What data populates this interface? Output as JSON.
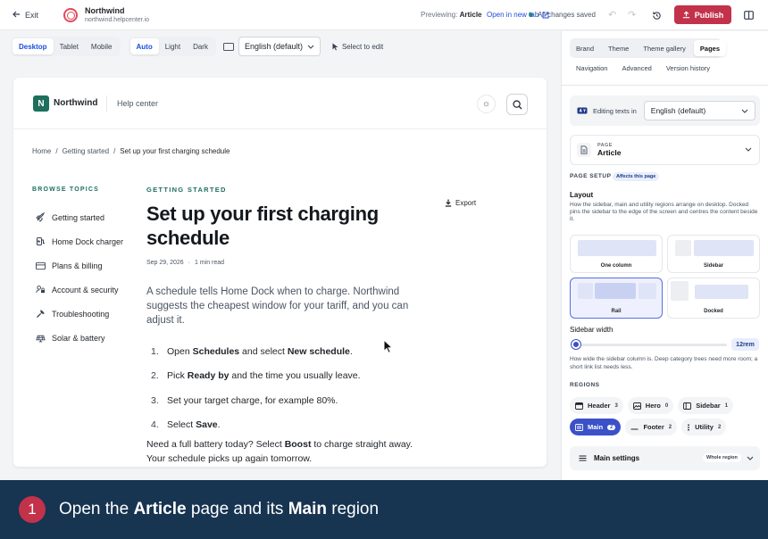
{
  "topbar": {
    "exit_label": "Exit",
    "brand_name": "Northwind",
    "brand_url": "northwind.helpcenter.io",
    "status": "All changes saved",
    "publish_label": "Publish"
  },
  "toolbar": {
    "devices": [
      "Desktop",
      "Tablet",
      "Mobile"
    ],
    "active_device": "Desktop",
    "themes": [
      "Auto",
      "Light",
      "Dark"
    ],
    "active_theme": "Auto",
    "language": "English (default)",
    "select_to_edit": "Select to edit",
    "previewing_label": "Previewing:",
    "previewing_value": "Article",
    "open_new_tab": "Open in new tab"
  },
  "site": {
    "name": "Northwind",
    "logo_letter": "N",
    "help_center": "Help center",
    "breadcrumbs": [
      "Home",
      "Getting started",
      "Set up your first charging schedule"
    ],
    "browse_topics": "BROWSE TOPICS",
    "topics": [
      {
        "label": "Getting started",
        "icon": "rocket-icon"
      },
      {
        "label": "Home Dock charger",
        "icon": "charger-icon"
      },
      {
        "label": "Plans & billing",
        "icon": "card-icon"
      },
      {
        "label": "Account & security",
        "icon": "user-lock-icon"
      },
      {
        "label": "Troubleshooting",
        "icon": "wrench-icon"
      },
      {
        "label": "Solar & battery",
        "icon": "solar-icon"
      }
    ]
  },
  "article": {
    "category": "GETTING STARTED",
    "export": "Export",
    "title": "Set up your first charging schedule",
    "date": "Sep 29, 2026",
    "read_time": "1 min read",
    "lead": "A schedule tells Home Dock when to charge. Northwind suggests the cheapest window for your tariff, and you can adjust it.",
    "steps": [
      {
        "num": "1.",
        "parts": [
          "Open ",
          "Schedules",
          " and select ",
          "New schedule",
          "."
        ]
      },
      {
        "num": "2.",
        "parts": [
          "Pick ",
          "Ready by",
          " and the time you usually leave."
        ]
      },
      {
        "num": "3.",
        "parts": [
          "Set your target charge, for example 80%."
        ]
      },
      {
        "num": "4.",
        "parts": [
          "Select ",
          "Save",
          "."
        ]
      }
    ],
    "after": [
      "Need a full battery today? Select ",
      "Boost",
      " to charge straight away. Your schedule picks up again tomorrow."
    ]
  },
  "panel": {
    "tabs_row1": [
      "Brand",
      "Theme",
      "Theme gallery",
      "Pages"
    ],
    "tabs_row2": [
      "Navigation",
      "Advanced",
      "Version history"
    ],
    "active_tab": "Pages",
    "editing_texts_label": "Editing texts in",
    "editing_language": "English (default)",
    "page_kicker": "PAGE",
    "page_value": "Article",
    "page_setup": "PAGE SETUP",
    "affects": "Affects this page",
    "layout_title": "Layout",
    "layout_desc": "How the sidebar, main and utility regions arrange on desktop. Docked pins the sidebar to the edge of the screen and centres the content beside it.",
    "layouts": [
      "One column",
      "Sidebar",
      "Rail",
      "Docked"
    ],
    "selected_layout": "Rail",
    "sidebar_width_title": "Sidebar width",
    "sidebar_width_value": "12rem",
    "sidebar_width_fraction": 0.02,
    "sidebar_width_desc": "How wide the sidebar column is. Deep category trees need more room; a short link list needs less.",
    "regions_label": "REGIONS",
    "regions_row1": [
      {
        "name": "Header",
        "count": "3",
        "icon": "header-icon"
      },
      {
        "name": "Hero",
        "count": "0",
        "icon": "hero-icon"
      },
      {
        "name": "Sidebar",
        "count": "1",
        "icon": "sidebar-icon"
      }
    ],
    "regions_row2": [
      {
        "name": "Main",
        "count": "2",
        "icon": "main-icon",
        "selected": true
      },
      {
        "name": "Footer",
        "count": "2",
        "icon": "footer-icon"
      },
      {
        "name": "Utility",
        "count": "2",
        "icon": "utility-icon"
      }
    ],
    "main_settings": "Main settings",
    "whole_region": "Whole region"
  },
  "caption": {
    "step": "1",
    "parts": [
      "Open the ",
      "Article",
      " page and its ",
      "Main",
      " region"
    ]
  },
  "colors": {
    "accent": "#c2324a",
    "primary": "#3b51c8",
    "brand_green": "#1f6f5e",
    "caption_bg": "#173451"
  }
}
